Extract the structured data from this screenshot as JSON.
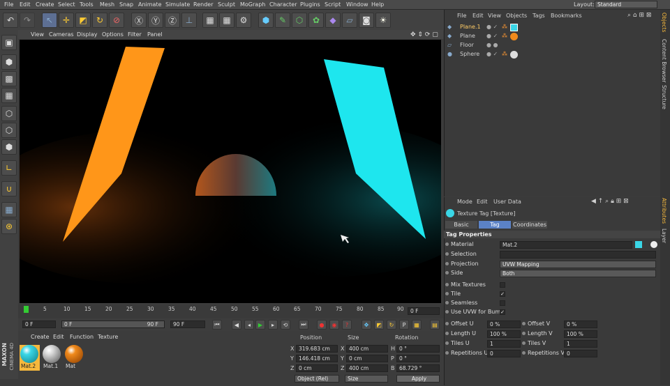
{
  "menubar": {
    "items": [
      "File",
      "Edit",
      "Create",
      "Select",
      "Tools",
      "Mesh",
      "Snap",
      "Animate",
      "Simulate",
      "Render",
      "Sculpt",
      "MoGraph",
      "Character",
      "Plugins",
      "Script",
      "Window",
      "Help"
    ],
    "layout_label": "Layout:",
    "layout_value": "Standard"
  },
  "viewport": {
    "menu": [
      "View",
      "Cameras",
      "Display",
      "Options",
      "Filter",
      "Panel"
    ]
  },
  "timeline": {
    "ticks": [
      "0",
      "5",
      "10",
      "15",
      "20",
      "25",
      "30",
      "35",
      "40",
      "45",
      "50",
      "55",
      "60",
      "65",
      "70",
      "75",
      "80",
      "85",
      "90"
    ],
    "end_frame": "0 F"
  },
  "playback": {
    "current": "0 F",
    "range_start": "0 F",
    "range_end": "90 F",
    "max": "90 F"
  },
  "material_manager": {
    "menu": [
      "Create",
      "Edit",
      "Function",
      "Texture"
    ],
    "materials": [
      {
        "name": "Mat.2",
        "color": "#3ad6e6"
      },
      {
        "name": "Mat.1",
        "color": "#d8d8d8"
      },
      {
        "name": "Mat",
        "color": "#f08a1c"
      }
    ]
  },
  "coordinates": {
    "headers": [
      "Position",
      "Size",
      "Rotation"
    ],
    "rows": [
      {
        "axis": "X",
        "pos": "319.683 cm",
        "saxis": "X",
        "size": "400 cm",
        "raxis": "H",
        "rot": "0 °"
      },
      {
        "axis": "Y",
        "pos": "146.418 cm",
        "saxis": "Y",
        "size": "0 cm",
        "raxis": "P",
        "rot": "0 °"
      },
      {
        "axis": "Z",
        "pos": "0 cm",
        "saxis": "Z",
        "size": "400 cm",
        "raxis": "B",
        "rot": "68.729 °"
      }
    ],
    "mode_select": "Object (Rel)",
    "size_select": "Size",
    "apply_label": "Apply"
  },
  "object_manager": {
    "menu": [
      "File",
      "Edit",
      "View",
      "Objects",
      "Tags",
      "Bookmarks"
    ],
    "objects": [
      {
        "name": "Plane.1",
        "selected": true
      },
      {
        "name": "Plane",
        "selected": false
      },
      {
        "name": "Floor",
        "selected": false
      },
      {
        "name": "Sphere",
        "selected": false
      }
    ]
  },
  "attributes": {
    "menu": [
      "Mode",
      "Edit",
      "User Data"
    ],
    "title": "Texture Tag [Texture]",
    "tabs": [
      "Basic",
      "Tag",
      "Coordinates"
    ],
    "section": "Tag Properties",
    "material_label": "Material",
    "material_value": "Mat.2",
    "selection_label": "Selection",
    "projection_label": "Projection",
    "projection_value": "UVW Mapping",
    "side_label": "Side",
    "side_value": "Both",
    "checks": [
      {
        "label": "Mix Textures",
        "checked": false
      },
      {
        "label": "Tile",
        "checked": true
      },
      {
        "label": "Seamless",
        "checked": false
      },
      {
        "label": "Use UVW for Bump",
        "checked": true
      }
    ],
    "offset_u_label": "Offset U",
    "offset_u": "0 %",
    "offset_v_label": "Offset V",
    "offset_v": "0 %",
    "length_u_label": "Length U",
    "length_u": "100 %",
    "length_v_label": "Length V",
    "length_v": "100 %",
    "tiles_u_label": "Tiles U",
    "tiles_u": "1",
    "tiles_v_label": "Tiles V",
    "tiles_v": "1",
    "rep_u_label": "Repetitions U",
    "rep_u": "0",
    "rep_v_label": "Repetitions V",
    "rep_v": "0"
  },
  "side_tabs": [
    "Objects",
    "Content Browser",
    "Structure",
    "Attributes",
    "Layer"
  ],
  "brand": {
    "line1": "MAXON",
    "line2": "CINEMA 4D"
  },
  "colors": {
    "accent": "#5b82c6",
    "orange": "#ff9619",
    "cyan": "#1ee6ee"
  }
}
